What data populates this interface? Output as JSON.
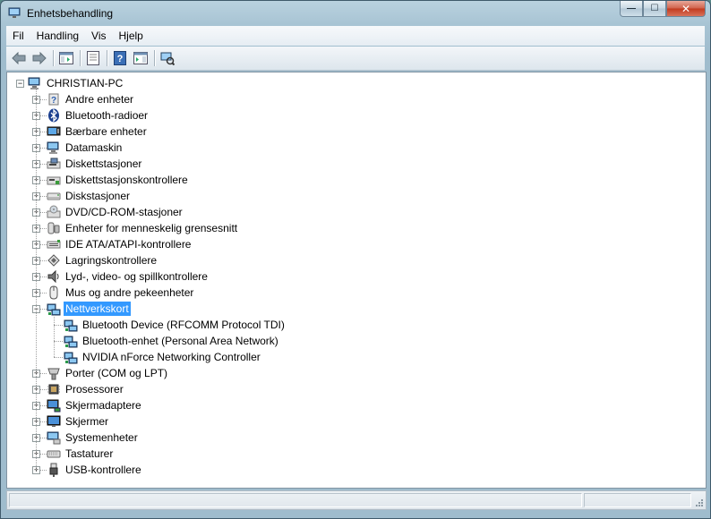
{
  "window": {
    "title": "Enhetsbehandling",
    "controls": {
      "minimize": "—",
      "maximize": "☐",
      "close": "✕"
    }
  },
  "menu": [
    {
      "id": "file",
      "label": "Fil"
    },
    {
      "id": "action",
      "label": "Handling"
    },
    {
      "id": "view",
      "label": "Vis"
    },
    {
      "id": "help",
      "label": "Hjelp"
    }
  ],
  "toolbar": {
    "buttons": [
      "back-icon",
      "forward-icon",
      "show-hide-console-tree-icon",
      "properties-icon",
      "help-icon",
      "show-hide-action-pane-icon",
      "scan-hardware-icon"
    ]
  },
  "tree": {
    "root": {
      "label": "CHRISTIAN-PC",
      "icon": "computer-icon"
    },
    "categories": [
      {
        "label": "Andre enheter",
        "icon": "unknown-device-icon"
      },
      {
        "label": "Bluetooth-radioer",
        "icon": "bluetooth-icon"
      },
      {
        "label": "Bærbare enheter",
        "icon": "portable-device-icon"
      },
      {
        "label": "Datamaskin",
        "icon": "computer-icon"
      },
      {
        "label": "Diskettstasjoner",
        "icon": "floppy-drive-icon"
      },
      {
        "label": "Diskettstasjonskontrollere",
        "icon": "floppy-controller-icon"
      },
      {
        "label": "Diskstasjoner",
        "icon": "disk-drive-icon"
      },
      {
        "label": "DVD/CD-ROM-stasjoner",
        "icon": "optical-drive-icon"
      },
      {
        "label": "Enheter for menneskelig grensesnitt",
        "icon": "hid-icon"
      },
      {
        "label": "IDE ATA/ATAPI-kontrollere",
        "icon": "ide-controller-icon"
      },
      {
        "label": "Lagringskontrollere",
        "icon": "storage-controller-icon"
      },
      {
        "label": "Lyd-, video- og spillkontrollere",
        "icon": "sound-icon"
      },
      {
        "label": "Mus og andre pekeenheter",
        "icon": "mouse-icon"
      },
      {
        "label": "Nettverkskort",
        "icon": "network-adapter-icon",
        "expanded": true,
        "selected": true,
        "children": [
          {
            "label": "Bluetooth Device (RFCOMM Protocol TDI)",
            "icon": "network-adapter-icon"
          },
          {
            "label": "Bluetooth-enhet (Personal Area Network)",
            "icon": "network-adapter-icon"
          },
          {
            "label": "NVIDIA nForce Networking Controller",
            "icon": "network-adapter-icon"
          }
        ]
      },
      {
        "label": "Porter (COM og LPT)",
        "icon": "port-icon"
      },
      {
        "label": "Prosessorer",
        "icon": "processor-icon"
      },
      {
        "label": "Skjermadaptere",
        "icon": "display-adapter-icon"
      },
      {
        "label": "Skjermer",
        "icon": "monitor-icon"
      },
      {
        "label": "Systemenheter",
        "icon": "system-device-icon"
      },
      {
        "label": "Tastaturer",
        "icon": "keyboard-icon"
      },
      {
        "label": "USB-kontrollere",
        "icon": "usb-icon"
      }
    ]
  }
}
